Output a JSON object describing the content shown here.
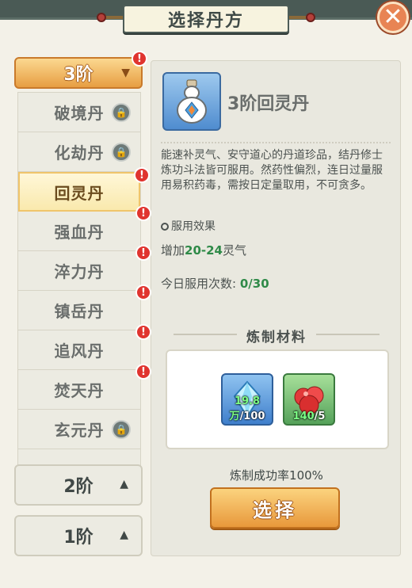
{
  "title": "选择丹方",
  "close_icon": "close-icon",
  "tiers": {
    "current": {
      "label": "3阶",
      "icon": "chevron-down-icon"
    },
    "others": [
      {
        "label": "2阶",
        "icon": "chevron-up-icon"
      },
      {
        "label": "1阶",
        "icon": "chevron-up-icon"
      }
    ]
  },
  "pill_list": [
    {
      "label": "破境丹",
      "status": "locked"
    },
    {
      "label": "化劫丹",
      "status": "locked"
    },
    {
      "label": "回灵丹",
      "status": "alert",
      "selected": true
    },
    {
      "label": "强血丹",
      "status": "alert"
    },
    {
      "label": "淬力丹",
      "status": "alert"
    },
    {
      "label": "镇岳丹",
      "status": "alert"
    },
    {
      "label": "追风丹",
      "status": "alert"
    },
    {
      "label": "焚天丹",
      "status": "alert"
    },
    {
      "label": "玄元丹",
      "status": "locked"
    }
  ],
  "detail": {
    "name": "3阶回灵丹",
    "description": "能速补灵气、安守道心的丹道珍品，结丹修士炼功斗法皆可服用。然药性偏烈，连日过量服用易积药毒，需按日定量取用，不可贪多。",
    "effect_heading": "服用效果",
    "effect_prefix": "增加",
    "effect_value": "20-24",
    "effect_suffix": "灵气",
    "usage_label": "今日服用次数:",
    "usage_value": "0/30"
  },
  "materials": {
    "title": "炼制材料",
    "items": [
      {
        "icon": "crystal-icon",
        "owned": "19.8万",
        "required": "/100"
      },
      {
        "icon": "red-herb-icon",
        "owned": "140",
        "required": "/5"
      }
    ]
  },
  "success_rate": "炼制成功率100%",
  "choose_label": "选择",
  "colors": {
    "accent": "#e8983b",
    "green": "#2f8a48",
    "alert": "#e0342f"
  }
}
